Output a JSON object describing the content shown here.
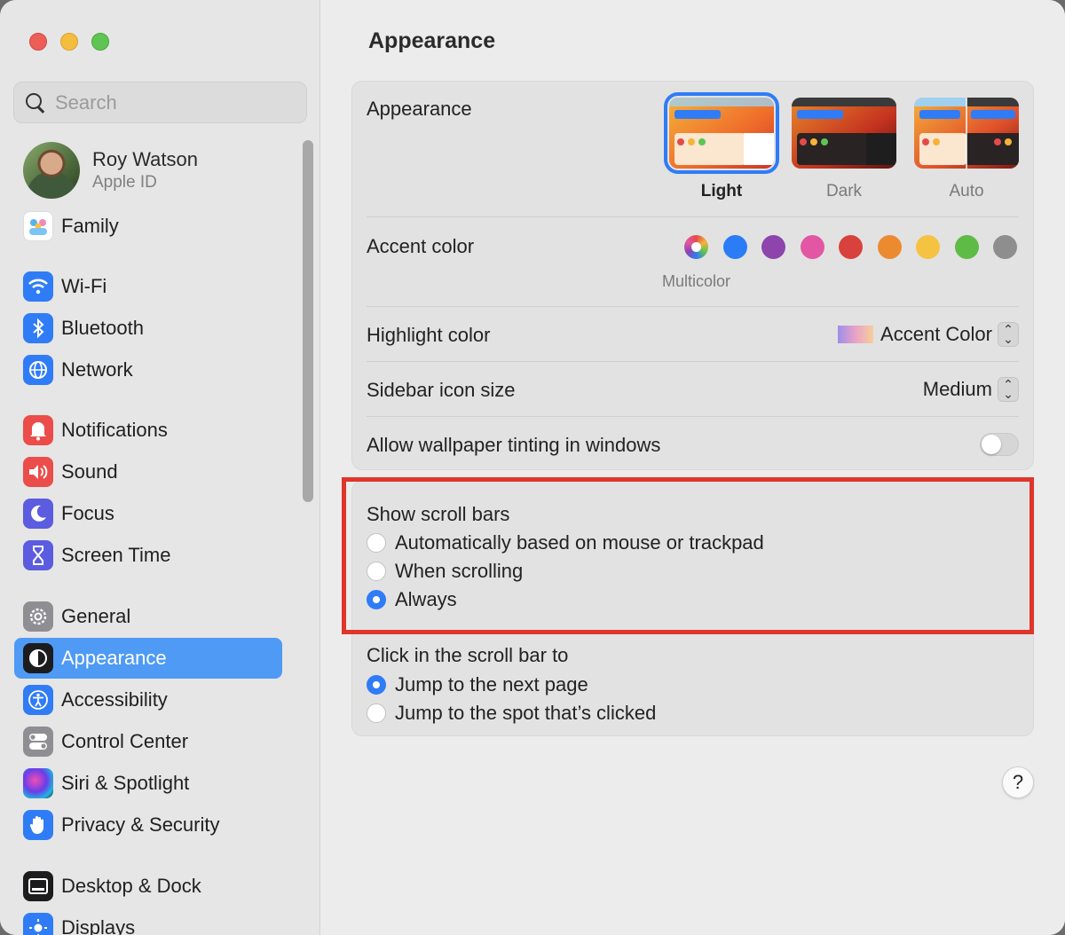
{
  "window": {
    "title": "Appearance"
  },
  "sidebar": {
    "search_placeholder": "Search",
    "account": {
      "name": "Roy Watson",
      "subtitle": "Apple ID"
    },
    "items": [
      {
        "label": "Family",
        "icon": "family-icon"
      },
      {
        "label": "Wi-Fi",
        "icon": "wifi-icon"
      },
      {
        "label": "Bluetooth",
        "icon": "bluetooth-icon"
      },
      {
        "label": "Network",
        "icon": "globe-icon"
      },
      {
        "label": "Notifications",
        "icon": "bell-icon"
      },
      {
        "label": "Sound",
        "icon": "speaker-icon"
      },
      {
        "label": "Focus",
        "icon": "moon-icon"
      },
      {
        "label": "Screen Time",
        "icon": "hourglass-icon"
      },
      {
        "label": "General",
        "icon": "gear-icon"
      },
      {
        "label": "Appearance",
        "icon": "appearance-icon",
        "selected": true
      },
      {
        "label": "Accessibility",
        "icon": "accessibility-icon"
      },
      {
        "label": "Control Center",
        "icon": "toggles-icon"
      },
      {
        "label": "Siri & Spotlight",
        "icon": "siri-icon"
      },
      {
        "label": "Privacy & Security",
        "icon": "hand-icon"
      },
      {
        "label": "Desktop & Dock",
        "icon": "dock-icon"
      },
      {
        "label": "Displays",
        "icon": "sun-icon"
      }
    ]
  },
  "main": {
    "title": "Appearance",
    "appearance": {
      "label": "Appearance",
      "options": [
        {
          "label": "Light",
          "selected": true
        },
        {
          "label": "Dark",
          "selected": false
        },
        {
          "label": "Auto",
          "selected": false
        }
      ]
    },
    "accent": {
      "label": "Accent color",
      "selected_name": "Multicolor",
      "colors": [
        "multicolor",
        "#2c7cf6",
        "#8e44ad",
        "#e356a3",
        "#d9413d",
        "#ec8a2f",
        "#f5c242",
        "#5dbb46",
        "#8e8e8e"
      ]
    },
    "highlight": {
      "label": "Highlight color",
      "value": "Accent Color"
    },
    "sidebar_icon_size": {
      "label": "Sidebar icon size",
      "value": "Medium"
    },
    "wallpaper_tinting": {
      "label": "Allow wallpaper tinting in windows",
      "enabled": false
    },
    "scroll_bars": {
      "label": "Show scroll bars",
      "options": [
        {
          "label": "Automatically based on mouse or trackpad",
          "selected": false
        },
        {
          "label": "When scrolling",
          "selected": false
        },
        {
          "label": "Always",
          "selected": true
        }
      ]
    },
    "click_scroll": {
      "label": "Click in the scroll bar to",
      "options": [
        {
          "label": "Jump to the next page",
          "selected": true
        },
        {
          "label": "Jump to the spot that’s clicked",
          "selected": false
        }
      ]
    },
    "help_label": "?"
  },
  "colors": {
    "accent": "#2f7cf6",
    "annotation_box": "#e0352b",
    "sidebar_selected": "#4e9af5"
  }
}
